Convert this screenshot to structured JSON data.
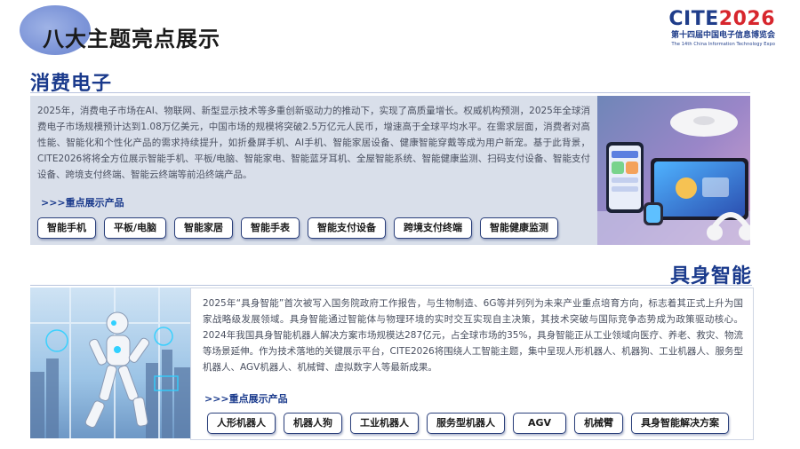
{
  "header": {
    "title": "八大主题亮点展示"
  },
  "logo": {
    "cite": "CITE",
    "year": "2026",
    "cn": "第十四届中国电子信息博览会",
    "en": "The 14th China Information Technology Expo"
  },
  "sections": [
    {
      "title": "消费电子",
      "paragraph": "2025年，消费电子市场在AI、物联网、新型显示技术等多重创新驱动力的推动下，实现了高质量增长。权威机构预测，2025年全球消费电子市场规模预计达到1.08万亿美元，中国市场的规模将突破2.5万亿元人民币，增速高于全球平均水平。在需求层面，消费者对高性能、智能化和个性化产品的需求持续提升，如折叠屏手机、AI手机、智能家居设备、健康智能穿戴等成为用户新宠。基于此背景，CITE2026将将全方位展示智能手机、平板/电脑、智能家电、智能蓝牙耳机、全屋智能系统、智能健康监测、扫码支付设备、智能支付设备、跨境支付终端、智能云终端等前沿终端产品。",
      "sub_label": ">>>重点展示产品",
      "tags": [
        "智能手机",
        "平板/电脑",
        "智能家居",
        "智能手表",
        "智能支付设备",
        "跨境支付终端",
        "智能健康监测"
      ]
    },
    {
      "title": "具身智能",
      "paragraph": "2025年“具身智能”首次被写入国务院政府工作报告，与生物制造、6G等并列列为未来产业重点培育方向，标志着其正式上升为国家战略级发展领域。具身智能通过智能体与物理环境的实时交互实现自主决策，其技术突破与国际竞争态势成为政策驱动核心。2024年我国具身智能机器人解决方案市场规模达287亿元，占全球市场的35%，具身智能正从工业领域向医疗、养老、救灾、物流等场景延伸。作为技术落地的关键展示平台，CITE2026将围绕人工智能主题，集中呈现人形机器人、机器狗、工业机器人、服务型机器人、AGV机器人、机械臂、虚拟数字人等最新成果。",
      "sub_label": ">>>重点展示产品",
      "tags": [
        "人形机器人",
        "机器人狗",
        "工业机器人",
        "服务型机器人",
        "AGV",
        "机械臂",
        "具身智能解决方案"
      ]
    }
  ],
  "colors": {
    "accent": "#1a3a8c",
    "brand_red": "#d7262d",
    "panel_bg": "#d9dfea"
  }
}
